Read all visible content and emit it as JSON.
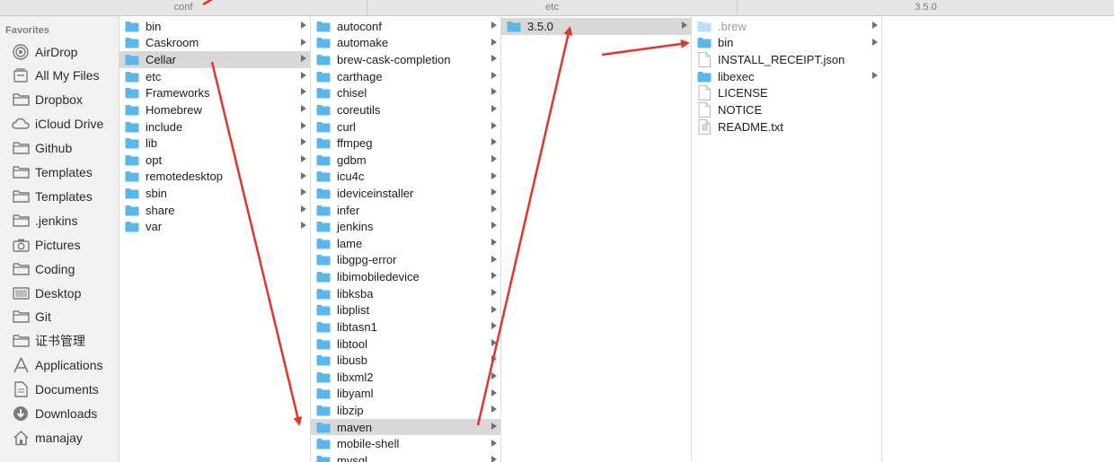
{
  "tabbar": {
    "tabs": [
      "conf",
      "etc",
      "3.5.0"
    ]
  },
  "sidebar": {
    "heading": "Favorites",
    "items": [
      {
        "label": "AirDrop",
        "icon": "airdrop-icon"
      },
      {
        "label": "All My Files",
        "icon": "all-files-icon"
      },
      {
        "label": "Dropbox",
        "icon": "folder-icon"
      },
      {
        "label": "iCloud Drive",
        "icon": "cloud-icon"
      },
      {
        "label": "Github",
        "icon": "folder-icon"
      },
      {
        "label": "Templates",
        "icon": "folder-icon"
      },
      {
        "label": "Templates",
        "icon": "folder-icon"
      },
      {
        "label": ".jenkins",
        "icon": "folder-icon"
      },
      {
        "label": "Pictures",
        "icon": "camera-icon"
      },
      {
        "label": "Coding",
        "icon": "folder-icon"
      },
      {
        "label": "Desktop",
        "icon": "desktop-icon"
      },
      {
        "label": "Git",
        "icon": "folder-icon"
      },
      {
        "label": "证书管理",
        "icon": "folder-icon"
      },
      {
        "label": "Applications",
        "icon": "applications-icon"
      },
      {
        "label": "Documents",
        "icon": "documents-icon"
      },
      {
        "label": "Downloads",
        "icon": "downloads-icon"
      },
      {
        "label": "manajay",
        "icon": "home-icon"
      }
    ]
  },
  "columns": [
    {
      "items": [
        {
          "name": "bin",
          "type": "folder",
          "arrow": true
        },
        {
          "name": "Caskroom",
          "type": "folder",
          "arrow": true
        },
        {
          "name": "Cellar",
          "type": "folder",
          "arrow": true,
          "selected": true
        },
        {
          "name": "etc",
          "type": "folder",
          "arrow": true
        },
        {
          "name": "Frameworks",
          "type": "folder",
          "arrow": true
        },
        {
          "name": "Homebrew",
          "type": "folder",
          "arrow": true
        },
        {
          "name": "include",
          "type": "folder",
          "arrow": true
        },
        {
          "name": "lib",
          "type": "folder",
          "arrow": true
        },
        {
          "name": "opt",
          "type": "folder",
          "arrow": true
        },
        {
          "name": "remotedesktop",
          "type": "folder",
          "arrow": true
        },
        {
          "name": "sbin",
          "type": "folder",
          "arrow": true
        },
        {
          "name": "share",
          "type": "folder",
          "arrow": true
        },
        {
          "name": "var",
          "type": "folder",
          "arrow": true
        }
      ]
    },
    {
      "items": [
        {
          "name": "autoconf",
          "type": "folder",
          "arrow": true
        },
        {
          "name": "automake",
          "type": "folder",
          "arrow": true
        },
        {
          "name": "brew-cask-completion",
          "type": "folder",
          "arrow": true
        },
        {
          "name": "carthage",
          "type": "folder",
          "arrow": true
        },
        {
          "name": "chisel",
          "type": "folder",
          "arrow": true
        },
        {
          "name": "coreutils",
          "type": "folder",
          "arrow": true
        },
        {
          "name": "curl",
          "type": "folder",
          "arrow": true
        },
        {
          "name": "ffmpeg",
          "type": "folder",
          "arrow": true
        },
        {
          "name": "gdbm",
          "type": "folder",
          "arrow": true
        },
        {
          "name": "icu4c",
          "type": "folder",
          "arrow": true
        },
        {
          "name": "ideviceinstaller",
          "type": "folder",
          "arrow": true
        },
        {
          "name": "infer",
          "type": "folder",
          "arrow": true
        },
        {
          "name": "jenkins",
          "type": "folder",
          "arrow": true
        },
        {
          "name": "lame",
          "type": "folder",
          "arrow": true
        },
        {
          "name": "libgpg-error",
          "type": "folder",
          "arrow": true
        },
        {
          "name": "libimobiledevice",
          "type": "folder",
          "arrow": true
        },
        {
          "name": "libksba",
          "type": "folder",
          "arrow": true
        },
        {
          "name": "libplist",
          "type": "folder",
          "arrow": true
        },
        {
          "name": "libtasn1",
          "type": "folder",
          "arrow": true
        },
        {
          "name": "libtool",
          "type": "folder",
          "arrow": true
        },
        {
          "name": "libusb",
          "type": "folder",
          "arrow": true
        },
        {
          "name": "libxml2",
          "type": "folder",
          "arrow": true
        },
        {
          "name": "libyaml",
          "type": "folder",
          "arrow": true
        },
        {
          "name": "libzip",
          "type": "folder",
          "arrow": true
        },
        {
          "name": "maven",
          "type": "folder",
          "arrow": true,
          "selected": true
        },
        {
          "name": "mobile-shell",
          "type": "folder",
          "arrow": true
        },
        {
          "name": "mysql",
          "type": "folder",
          "arrow": true
        }
      ]
    },
    {
      "items": [
        {
          "name": "3.5.0",
          "type": "folder",
          "arrow": true,
          "selected": true
        }
      ]
    },
    {
      "items": [
        {
          "name": ".brew",
          "type": "folder-light",
          "arrow": true,
          "dim": true
        },
        {
          "name": "bin",
          "type": "folder",
          "arrow": true
        },
        {
          "name": "INSTALL_RECEIPT.json",
          "type": "file",
          "arrow": false
        },
        {
          "name": "libexec",
          "type": "folder",
          "arrow": true
        },
        {
          "name": "LICENSE",
          "type": "file",
          "arrow": false
        },
        {
          "name": "NOTICE",
          "type": "file",
          "arrow": false
        },
        {
          "name": "README.txt",
          "type": "doc",
          "arrow": false
        }
      ]
    }
  ],
  "colors": {
    "folder": "#5ab7ec",
    "folder_light": "#b9e1f6",
    "arrow": "#e53324",
    "selection": "#d8d8d8"
  }
}
